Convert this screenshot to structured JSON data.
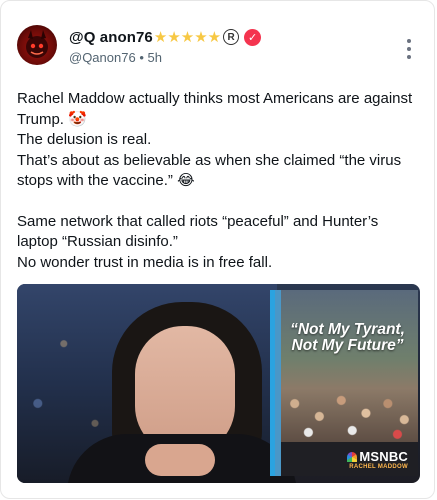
{
  "post": {
    "author": {
      "display_name": "@Q anon76",
      "stars": "★★★★★",
      "registered_mark": "R",
      "verified_mark": "✓",
      "handle": "@Qanon76",
      "separator": "•",
      "time_ago": "5h"
    },
    "menu_icon": "more-vertical-icon",
    "body": {
      "line1": "Rachel Maddow actually thinks most Americans are against Trump. 🤡",
      "line2": "The delusion is real.",
      "line3": "That’s about as believable as when she claimed “the virus stops with the vaccine.” 😂",
      "line4": "Same network that called riots “peaceful” and Hunter’s laptop “Russian disinfo.”",
      "line5": "No wonder trust in media is in free fall."
    },
    "media": {
      "inset_headline_1": "“Not My Tyrant,",
      "inset_headline_2": "Not My Future”",
      "brand": "MSNBC",
      "show": "RACHEL MADDOW"
    }
  },
  "colors": {
    "star": "#f7c844",
    "verified": "#f4344f",
    "muted": "#536471",
    "inset_blue": "#4a97c7"
  }
}
